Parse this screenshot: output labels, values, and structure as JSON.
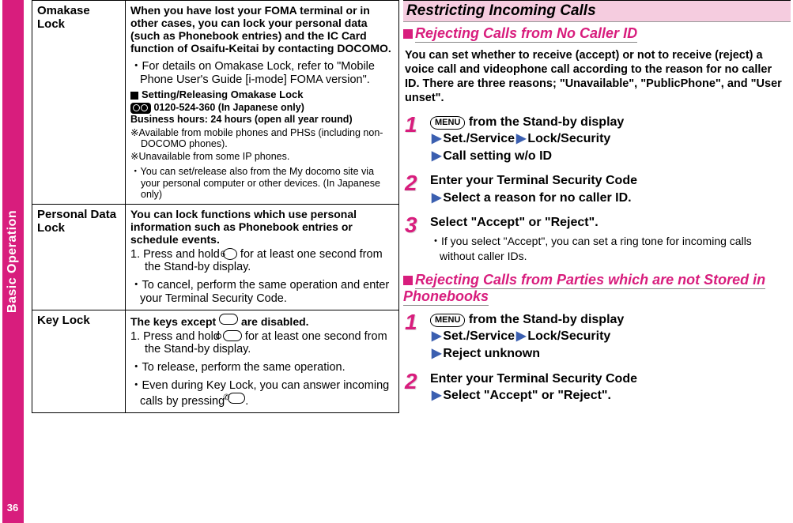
{
  "sidebar": {
    "label": "Basic Operation"
  },
  "page_number": "36",
  "table": {
    "rows": [
      {
        "label": "Omakase Lock",
        "lead": "When you have lost your FOMA terminal or in other cases, you can lock your personal data (such as Phonebook entries) and the IC Card function of Osaifu-Keitai by contacting DOCOMO.",
        "bullets": [
          "For details on Omakase Lock, refer to \"Mobile Phone User's Guide [i-mode] FOMA version\"."
        ],
        "subhead": "Setting/Releasing Omakase Lock",
        "phone": "0120-524-360 (In Japanese only)",
        "hours": "Business hours: 24 hours (open all year round)",
        "notes": [
          "※Available from mobile phones and PHSs (including non-DOCOMO phones).",
          "※Unavailable from some IP phones.",
          "・You can set/release also from the My docomo site via your personal computer or other devices. (In Japanese only)"
        ]
      },
      {
        "label": "Personal Data Lock",
        "lead": "You can lock functions which use personal information such as Phonebook entries or schedule events.",
        "num_key": "6",
        "num1_a": "1. Press and hold ",
        "num1_b": " for at least one second from the Stand-by display.",
        "bullets": [
          "To cancel, perform the same operation and enter your Terminal Security Code."
        ]
      },
      {
        "label": "Key Lock",
        "lead_a": "The keys except ",
        "lead_b": " are disabled.",
        "num1_a": "1. Press and hold ",
        "num1_b": " for at least one second from the Stand-by display.",
        "bullets_a": "To release, perform the same operation.",
        "bullets_b_a": "Even during Key Lock, you can answer incoming calls by pressing ",
        "bullets_b_b": "."
      }
    ]
  },
  "right": {
    "title": "Restricting Incoming Calls",
    "sub1": {
      "title": "Rejecting Calls from No Caller ID",
      "intro": "You can set whether to receive (accept) or not to receive (reject) a voice call and videophone call according to the reason for no caller ID. There are three reasons; \"Unavailable\", \"PublicPhone\", and \"User unset\".",
      "steps": [
        {
          "num": "1",
          "body_a": " from the Stand-by display",
          "path": [
            "Set./Service",
            "Lock/Security",
            "Call setting w/o ID"
          ],
          "menu": "MENU"
        },
        {
          "num": "2",
          "line1": "Enter your Terminal Security Code",
          "line2": "Select a reason for no caller ID."
        },
        {
          "num": "3",
          "line1": "Select \"Accept\" or \"Reject\".",
          "sub": "If you select \"Accept\", you can set a ring tone for incoming calls without caller IDs."
        }
      ]
    },
    "sub2": {
      "title": "Rejecting Calls from Parties which are not Stored in Phonebooks",
      "steps": [
        {
          "num": "1",
          "body_a": " from the Stand-by display",
          "path": [
            "Set./Service",
            "Lock/Security",
            "Reject unknown"
          ],
          "menu": "MENU"
        },
        {
          "num": "2",
          "line1": "Enter your Terminal Security Code",
          "line2": "Select \"Accept\" or \"Reject\"."
        }
      ]
    }
  }
}
